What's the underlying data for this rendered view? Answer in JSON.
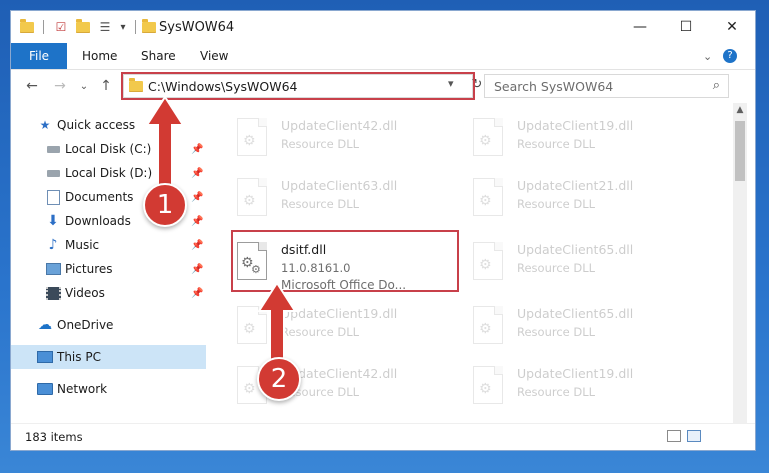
{
  "window": {
    "title": "SysWOW64",
    "controls": {
      "minimize": "—",
      "maximize": "☐",
      "close": "✕"
    }
  },
  "ribbon": {
    "tabs": [
      "File",
      "Home",
      "Share",
      "View"
    ],
    "expand_icon": "chevron-down-icon",
    "help_icon": "help-icon",
    "help_label": "?"
  },
  "address_bar": {
    "path": "C:\\Windows\\SysWOW64",
    "dropdown": "▾",
    "refresh": "↻"
  },
  "search": {
    "placeholder": "Search SysWOW64",
    "icon": "search-icon"
  },
  "nav_pane": {
    "items": [
      {
        "label": "Quick access",
        "icon": "star-icon",
        "pinned": false
      },
      {
        "label": "Local Disk (C:)",
        "icon": "drive-icon",
        "pinned": true
      },
      {
        "label": "Local Disk (D:)",
        "icon": "drive-icon",
        "pinned": true
      },
      {
        "label": "Documents",
        "icon": "documents-icon",
        "pinned": true
      },
      {
        "label": "Downloads",
        "icon": "download-arrow-icon",
        "pinned": true
      },
      {
        "label": "Music",
        "icon": "music-note-icon",
        "pinned": true
      },
      {
        "label": "Pictures",
        "icon": "pictures-icon",
        "pinned": true
      },
      {
        "label": "Videos",
        "icon": "film-icon",
        "pinned": true
      },
      {
        "label": "OneDrive",
        "icon": "cloud-icon",
        "pinned": false
      },
      {
        "label": "This PC",
        "icon": "computer-icon",
        "pinned": false,
        "selected": true
      },
      {
        "label": "Network",
        "icon": "network-icon",
        "pinned": false
      }
    ]
  },
  "files": {
    "left_column": [
      {
        "name": "UpdateClient42.dll",
        "desc": "Resource DLL"
      },
      {
        "name": "UpdateClient63.dll",
        "desc": "Resource DLL"
      },
      {
        "name": "dsitf.dll",
        "version": "11.0.8161.0",
        "company": "Microsoft Office Do...",
        "highlighted": true
      },
      {
        "name": "UpdateClient19.dll",
        "desc": "Resource DLL"
      },
      {
        "name": "UpdateClient42.dll",
        "desc": "Resource DLL"
      }
    ],
    "right_column": [
      {
        "name": "UpdateClient19.dll",
        "desc": "Resource DLL"
      },
      {
        "name": "UpdateClient21.dll",
        "desc": "Resource DLL"
      },
      {
        "name": "UpdateClient65.dll",
        "desc": "Resource DLL"
      },
      {
        "name": "UpdateClient65.dll",
        "desc": "Resource DLL"
      },
      {
        "name": "UpdateClient19.dll",
        "desc": "Resource DLL"
      }
    ]
  },
  "status_bar": {
    "item_count": "183 items"
  },
  "annotations": {
    "step1": "1",
    "step2": "2",
    "highlight_color": "#c8404a",
    "badge_color": "#d23a33"
  },
  "colors": {
    "file_tab": "#1e73c8",
    "selected_nav": "#cce4f7",
    "desktop": "#2a74cc"
  }
}
